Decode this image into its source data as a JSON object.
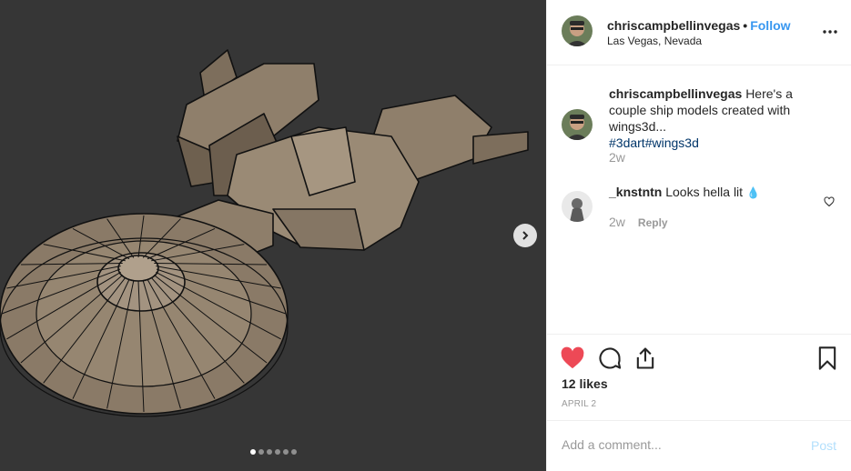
{
  "post": {
    "author": "chriscampbellinvegas",
    "follow_label": "Follow",
    "separator": "•",
    "location": "Las Vegas, Nevada",
    "more_icon": "more-horizontal-icon"
  },
  "media": {
    "subject": "wireframe starship model",
    "next_icon": "chevron-right-icon",
    "carousel_count": 6,
    "carousel_active": 1
  },
  "comments": [
    {
      "user": "chriscampbellinvegas",
      "text": "Here's a couple ship models created with wings3d...",
      "hashtags": [
        "#3dart",
        "#wings3d"
      ],
      "time": "2w"
    },
    {
      "user": "_knstntn",
      "text": "Looks hella lit",
      "emoji": "💧",
      "time": "2w",
      "reply_label": "Reply"
    }
  ],
  "actions": {
    "liked": true,
    "like_color": "#ed4956",
    "likes_text": "12 likes",
    "date": "APRIL 2"
  },
  "composer": {
    "placeholder": "Add a comment...",
    "post_label": "Post"
  },
  "colors": {
    "accent": "#3897f0",
    "hashtag": "#003569",
    "media_bg": "#363636",
    "hull": "#8a7a67"
  }
}
